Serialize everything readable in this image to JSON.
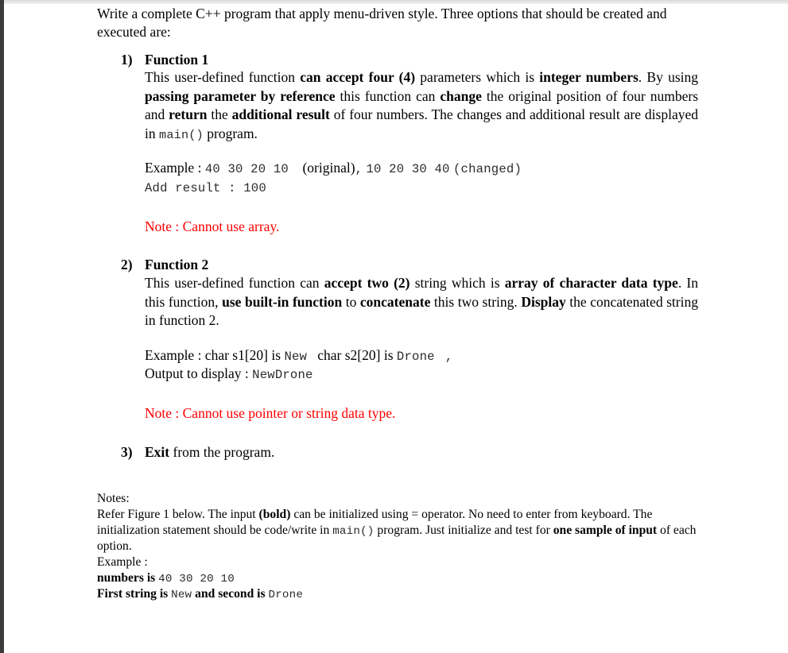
{
  "document": {
    "intro": {
      "text": "Write a complete C++ program that apply menu-driven style. Three options that should be created and executed are:"
    },
    "items": [
      {
        "marker": "1)",
        "title": "Function 1",
        "body": {
          "p1": "This user-defined function ",
          "b1": "can accept four (4)",
          "p2": " parameters which is ",
          "b2": "integer numbers",
          "p3": ". By using ",
          "b3": "passing parameter by reference",
          "p4": " this function can ",
          "b4": "change",
          "p5": " the original position of four numbers and ",
          "b5": "return",
          "p6": " the ",
          "b6": "additional result",
          "p7": " of four numbers.  The changes and additional result are displayed in ",
          "code1": "main()",
          "p8": " program."
        },
        "example": {
          "label": "Example :",
          "values_original": "40 30 20 10",
          "original_tag": "(original)",
          "comma": ",",
          "values_changed": "10 20 30 40",
          "changed_tag": "(changed)",
          "result_line": "Add result : 100"
        },
        "note": "Note : Cannot use array."
      },
      {
        "marker": "2)",
        "title": "Function 2",
        "body": {
          "p1": "This user-defined function can ",
          "b1": "accept two (2)",
          "p2": " string which is ",
          "b2": "array of character data type",
          "p3": ". In this function, ",
          "b3": "use built-in function",
          "p4": " to ",
          "b4": "concatenate",
          "p5": " this two string. ",
          "b5": "Display",
          "p6": " the concatenated string in function 2."
        },
        "example": {
          "label": "Example : char s1[20] is ",
          "s1_value": "New",
          "mid": "char s2[20] is ",
          "s2_value": "Drone",
          "trailing_comma": ",",
          "output_label": "Output to display : ",
          "output_value": "NewDrone"
        },
        "note": "Note : Cannot use pointer or string data type."
      },
      {
        "marker": "3)",
        "title": "Exit",
        "title_rest": " from the program."
      }
    ],
    "notes": {
      "heading": "Notes:",
      "line1_a": "Refer Figure 1 below. The input ",
      "line1_bold": "(bold)",
      "line1_b": " can be initialized using = operator. No need to enter from keyboard. The initialization statement should be code/write in ",
      "line1_code": "main()",
      "line1_c": " program. Just initialize and test for ",
      "line1_bold2": "one sample of input",
      "line1_d": " of each option.",
      "example_label": "Example :",
      "numbers_label": "numbers is ",
      "numbers_value": "40  30  20  10",
      "strings_label_a": "First string is ",
      "strings_value_1": "New",
      "strings_label_b": " and second is ",
      "strings_value_2": "Drone"
    }
  },
  "colors": {
    "note_red": "#ff0000",
    "text_black": "#000000",
    "code_gray": "#2b2b2b",
    "left_border": "#3b3b3b"
  }
}
